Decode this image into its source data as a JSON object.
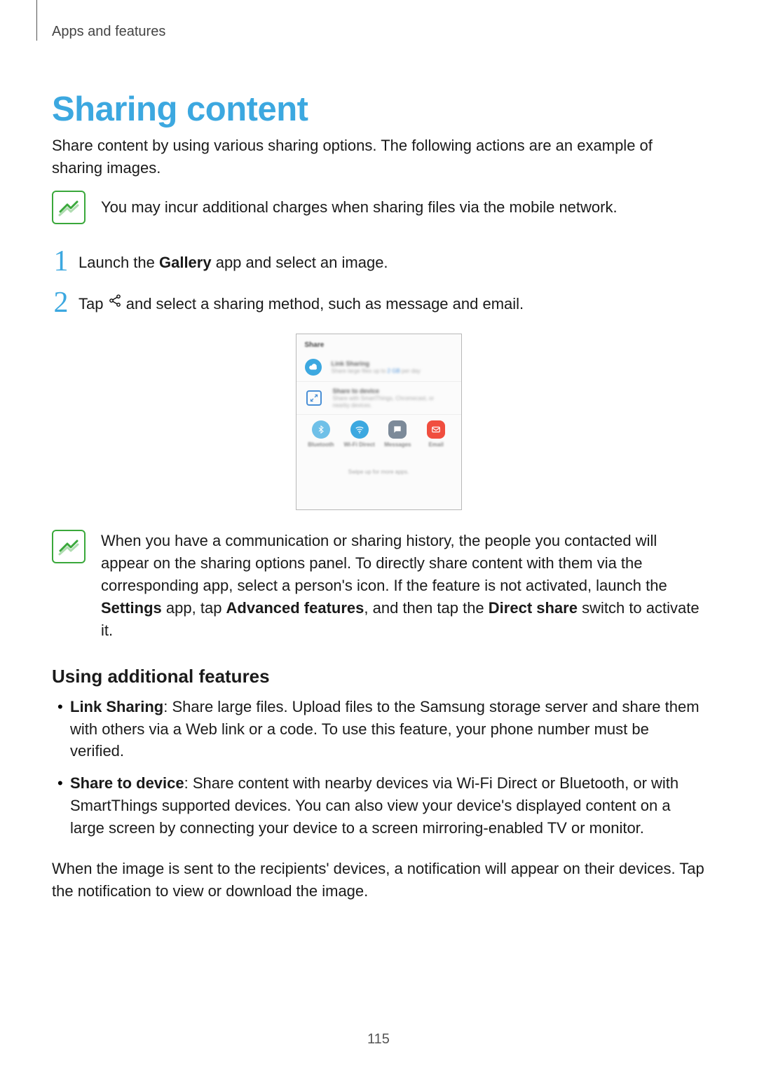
{
  "breadcrumb": "Apps and features",
  "title": "Sharing content",
  "intro": "Share content by using various sharing options. The following actions are an example of sharing images.",
  "note1": "You may incur additional charges when sharing files via the mobile network.",
  "steps": {
    "s1": {
      "num": "1",
      "pre": "Launch the ",
      "bold": "Gallery",
      "post": " app and select an image."
    },
    "s2": {
      "num": "2",
      "pre": "Tap ",
      "post": " and select a sharing method, such as message and email."
    }
  },
  "screenshot": {
    "header": "Share",
    "row1": {
      "title": "Link Sharing",
      "sub1": "Share large files up to ",
      "hl": "2 GB",
      "sub2": " per day"
    },
    "row2": {
      "title": "Share to device",
      "sub": "Share with SmartThings, Chromecast, or nearby devices."
    },
    "apps": {
      "bt": "Bluetooth",
      "wf": "Wi-Fi Direct",
      "mg": "Messages",
      "em": "Email"
    },
    "swipe": "Swipe up for more apps."
  },
  "note2": {
    "p1": "When you have a communication or sharing history, the people you contacted will appear on the sharing options panel. To directly share content with them via the corresponding app, select a person's icon. If the feature is not activated, launch the ",
    "b1": "Settings",
    "p2": " app, tap ",
    "b2": "Advanced features",
    "p3": ", and then tap the ",
    "b3": "Direct share",
    "p4": " switch to activate it."
  },
  "subheading": "Using additional features",
  "features": {
    "f1": {
      "b": "Link Sharing",
      "t": ": Share large files. Upload files to the Samsung storage server and share them with others via a Web link or a code. To use this feature, your phone number must be verified."
    },
    "f2": {
      "b": "Share to device",
      "t": ": Share content with nearby devices via Wi-Fi Direct or Bluetooth, or with SmartThings supported devices. You can also view your device's displayed content on a large screen by connecting your device to a screen mirroring-enabled TV or monitor."
    }
  },
  "closing": "When the image is sent to the recipients' devices, a notification will appear on their devices. Tap the notification to view or download the image.",
  "page_number": "115"
}
